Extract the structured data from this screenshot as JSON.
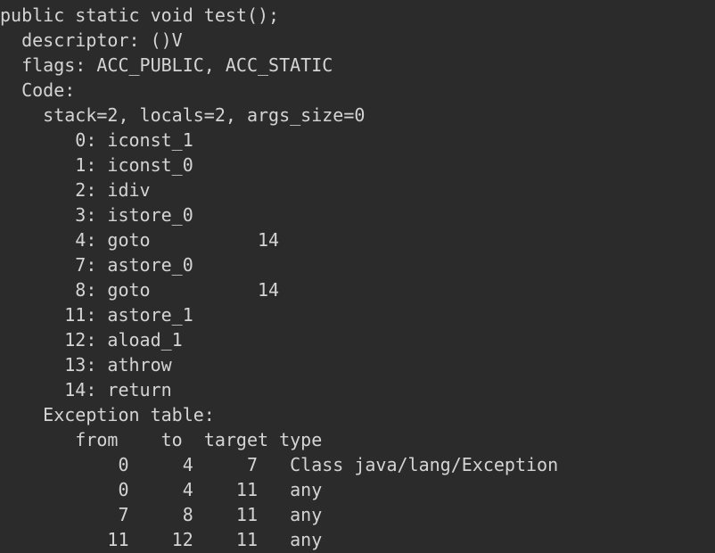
{
  "code_lines": [
    "public static void test();",
    "  descriptor: ()V",
    "  flags: ACC_PUBLIC, ACC_STATIC",
    "  Code:",
    "    stack=2, locals=2, args_size=0",
    "       0: iconst_1",
    "       1: iconst_0",
    "       2: idiv",
    "       3: istore_0",
    "       4: goto          14",
    "       7: astore_0",
    "       8: goto          14",
    "      11: astore_1",
    "      12: aload_1",
    "      13: athrow",
    "      14: return",
    "    Exception table:",
    "       from    to  target type",
    "           0     4     7   Class java/lang/Exception",
    "           0     4    11   any",
    "           7     8    11   any",
    "          11    12    11   any"
  ],
  "colors": {
    "background": "#2b2b2b",
    "text": "#d4d4d4"
  }
}
